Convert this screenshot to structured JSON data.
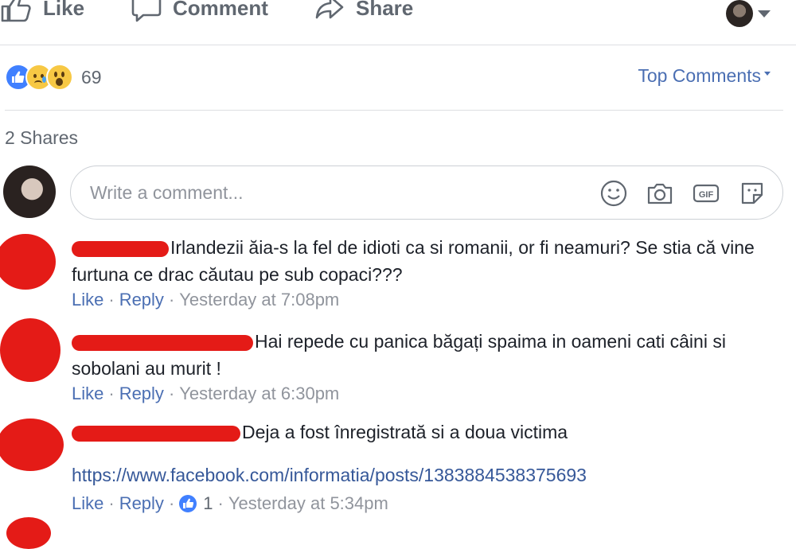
{
  "actions": {
    "like": "Like",
    "comment": "Comment",
    "share": "Share"
  },
  "reactions": {
    "types": [
      "like",
      "sad",
      "wow"
    ],
    "count": "69"
  },
  "sort": {
    "label": "Top Comments"
  },
  "shares": "2 Shares",
  "composer": {
    "placeholder": "Write a comment..."
  },
  "comments": [
    {
      "text": "Irlandezii ăia-s la fel de idioti ca si romanii, or fi neamuri? Se stia că vine furtuna ce drac căutau pe sub copaci???",
      "like": "Like",
      "reply": "Reply",
      "time": "Yesterday at 7:08pm"
    },
    {
      "text": "Hai repede cu panica băgați spaima in oameni cati câini si sobolani au murit !",
      "like": "Like",
      "reply": "Reply",
      "time": "Yesterday at 6:30pm"
    },
    {
      "text": "Deja a fost înregistrată si a doua victima",
      "link": "https://www.facebook.com/informatia/posts/1383884538375693",
      "like": "Like",
      "reply": "Reply",
      "reaction_count": "1",
      "time": "Yesterday at 5:34pm"
    }
  ]
}
